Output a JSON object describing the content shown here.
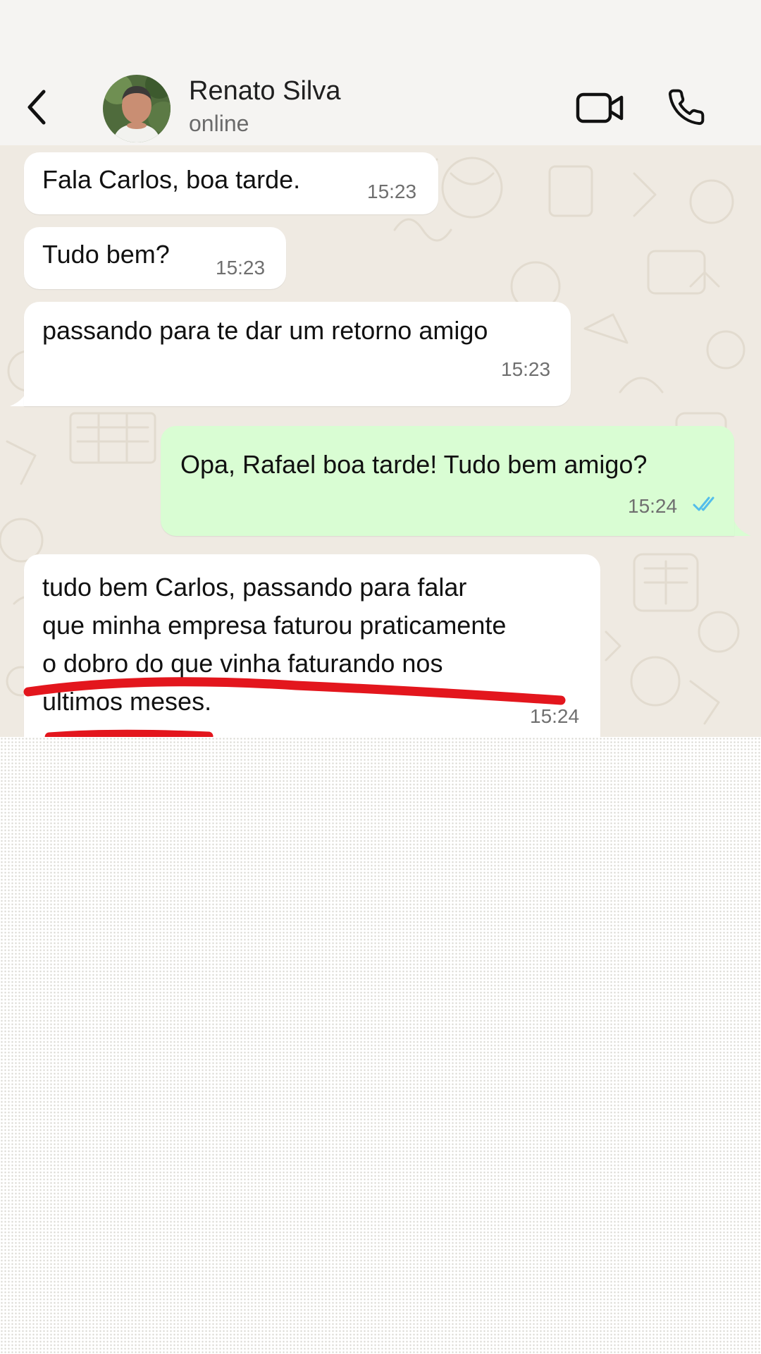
{
  "header": {
    "back_icon": "chevron-left-icon",
    "contact_name": "Renato Silva",
    "contact_status": "online",
    "video_icon": "video-camera-icon",
    "call_icon": "phone-icon"
  },
  "colors": {
    "header_bg": "#f5f4f2",
    "chat_bg": "#efeae2",
    "incoming_bubble": "#ffffff",
    "outgoing_bubble": "#d9fdd3",
    "read_ticks": "#53bdeb",
    "annotation_red": "#e3161d"
  },
  "messages": [
    {
      "direction": "incoming",
      "text": "Fala Carlos, boa tarde.",
      "time": "15:23"
    },
    {
      "direction": "incoming",
      "text": "Tudo bem?",
      "time": "15:23"
    },
    {
      "direction": "incoming",
      "text": "passando para te dar um retorno amigo",
      "time": "15:23"
    },
    {
      "direction": "outgoing",
      "text": "Opa, Rafael boa tarde! Tudo bem amigo?",
      "time": "15:24",
      "status": "read"
    },
    {
      "direction": "incoming",
      "lines": [
        "tudo bem Carlos, passando para falar",
        "que minha empresa faturou praticamente",
        "o dobro do que vinha faturando nos",
        "ultimos meses."
      ],
      "time": "15:24"
    }
  ],
  "annotation": "red-underline-marker"
}
